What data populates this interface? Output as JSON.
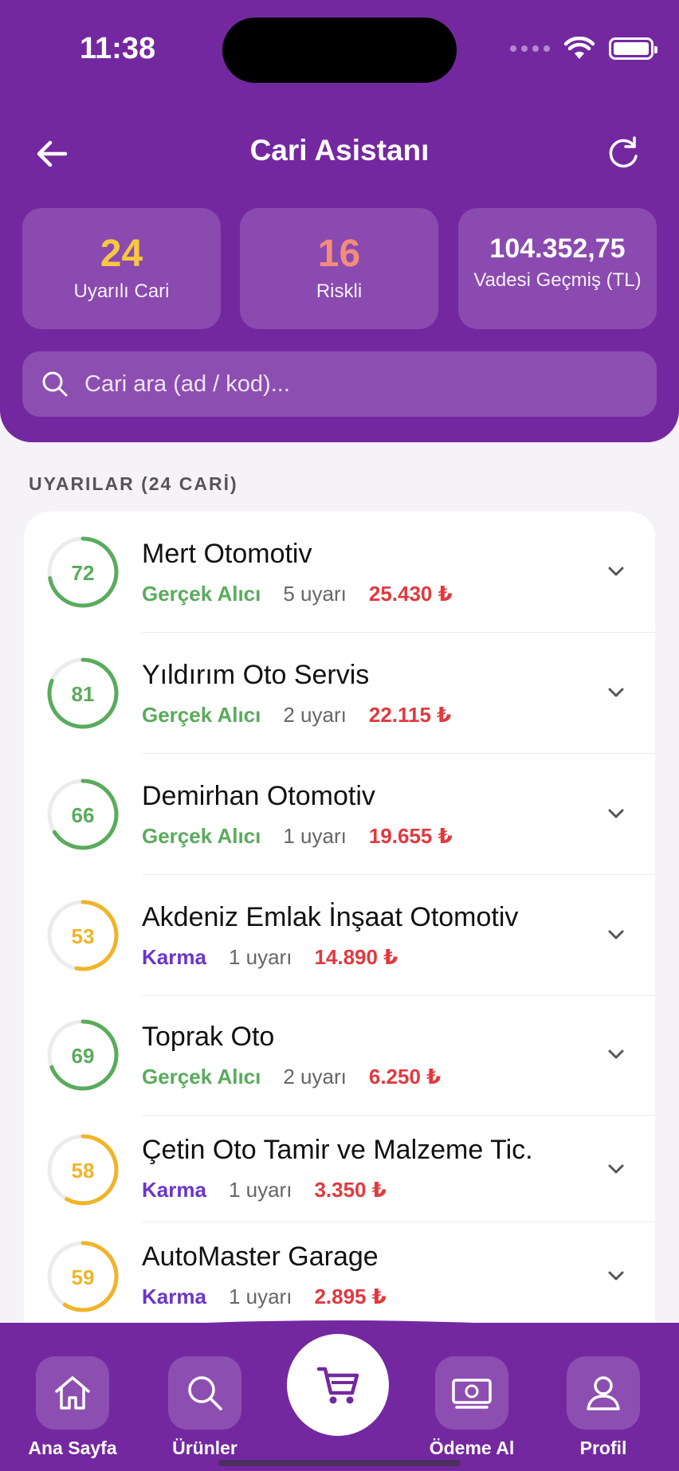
{
  "status_bar": {
    "time": "11:38"
  },
  "header": {
    "title": "Cari Asistanı"
  },
  "stats": [
    {
      "value": "24",
      "label": "Uyarılı Cari",
      "color": "#f6c842"
    },
    {
      "value": "16",
      "label": "Riskli",
      "color": "#f48c7c"
    },
    {
      "value": "104.352,75",
      "label": "Vadesi Geçmiş (TL)",
      "color": "#ffffff"
    }
  ],
  "search": {
    "placeholder": "Cari ara (ad / kod)..."
  },
  "section_title": "UYARILAR (24 CARİ)",
  "customers": [
    {
      "score": 72,
      "name": "Mert Otomotiv",
      "tag": "Gerçek Alıcı",
      "tag_type": "green",
      "warnings": "5 uyarı",
      "amount": "25.430 ₺"
    },
    {
      "score": 81,
      "name": "Yıldırım Oto Servis",
      "tag": "Gerçek Alıcı",
      "tag_type": "green",
      "warnings": "2 uyarı",
      "amount": "22.115 ₺"
    },
    {
      "score": 66,
      "name": "Demirhan Otomotiv",
      "tag": "Gerçek Alıcı",
      "tag_type": "green",
      "warnings": "1 uyarı",
      "amount": "19.655 ₺"
    },
    {
      "score": 53,
      "name": "Akdeniz Emlak İnşaat Otomotiv",
      "tag": "Karma",
      "tag_type": "purple",
      "warnings": "1 uyarı",
      "amount": "14.890 ₺"
    },
    {
      "score": 69,
      "name": "Toprak Oto",
      "tag": "Gerçek Alıcı",
      "tag_type": "green",
      "warnings": "2 uyarı",
      "amount": "6.250 ₺"
    },
    {
      "score": 58,
      "name": "Çetin Oto Tamir ve Malzeme Tic.",
      "tag": "Karma",
      "tag_type": "purple",
      "warnings": "1 uyarı",
      "amount": "3.350 ₺"
    },
    {
      "score": 59,
      "name": "AutoMaster Garage",
      "tag": "Karma",
      "tag_type": "purple",
      "warnings": "1 uyarı",
      "amount": "2.895 ₺"
    }
  ],
  "colors": {
    "primary": "#7428a0",
    "score_green": "#5aab5d",
    "score_orange": "#f0b429",
    "amount_red": "#e0393e"
  },
  "bottom_nav": [
    {
      "label": "Ana Sayfa",
      "icon": "home-icon"
    },
    {
      "label": "Ürünler",
      "icon": "search-icon"
    },
    {
      "label": "",
      "icon": "cart-icon"
    },
    {
      "label": "Ödeme Al",
      "icon": "cash-icon"
    },
    {
      "label": "Profil",
      "icon": "user-icon"
    }
  ]
}
